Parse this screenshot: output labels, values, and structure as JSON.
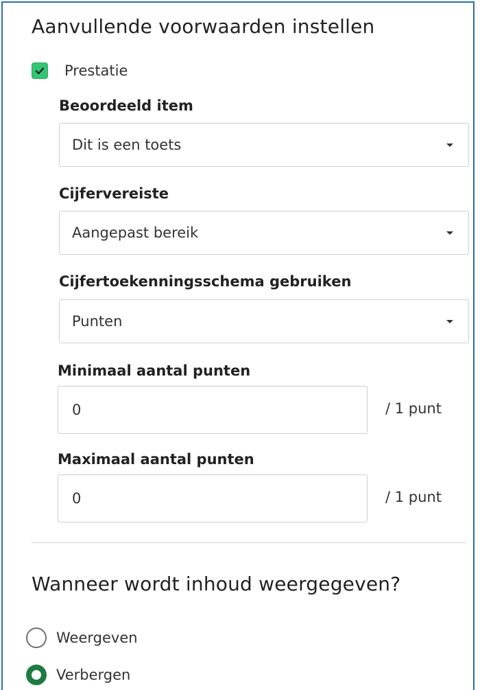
{
  "colors": {
    "accent": "#34c474",
    "frame_border": "#2e6fa8",
    "radio_selected": "#1f7a43"
  },
  "conditions": {
    "title": "Aanvullende voorwaarden instellen",
    "performance_checkbox": {
      "label": "Prestatie",
      "checked": true
    },
    "graded_item": {
      "label": "Beoordeeld item",
      "value": "Dit is een toets"
    },
    "grade_requirement": {
      "label": "Cijfervereiste",
      "value": "Aangepast bereik"
    },
    "grading_schema": {
      "label": "Cijfertoekenningsschema gebruiken",
      "value": "Punten"
    },
    "min_points": {
      "label": "Minimaal aantal punten",
      "value": "0",
      "suffix": "/ 1 punt"
    },
    "max_points": {
      "label": "Maximaal aantal punten",
      "value": "0",
      "suffix": "/ 1 punt"
    }
  },
  "visibility": {
    "title": "Wanneer wordt inhoud weergegeven?",
    "options": [
      {
        "label": "Weergeven",
        "selected": false
      },
      {
        "label": "Verbergen",
        "selected": true
      }
    ]
  }
}
